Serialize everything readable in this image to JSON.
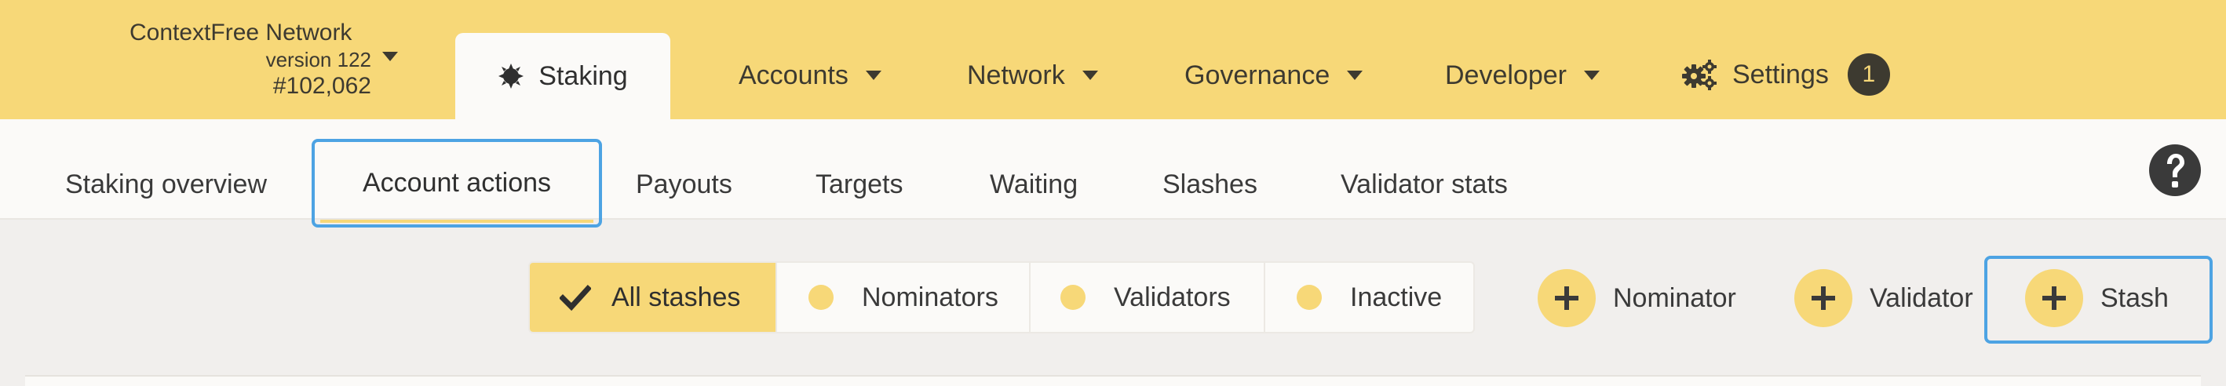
{
  "chain": {
    "name": "ContextFree Network",
    "version": "version 122",
    "block": "#102,062"
  },
  "top_menu": {
    "active_tab": "Staking",
    "accounts": "Accounts",
    "network": "Network",
    "governance": "Governance",
    "developer": "Developer",
    "settings": "Settings",
    "settings_badge": "1"
  },
  "sub_tabs": {
    "overview": "Staking overview",
    "account_actions": "Account actions",
    "payouts": "Payouts",
    "targets": "Targets",
    "waiting": "Waiting",
    "slashes": "Slashes",
    "validator_stats": "Validator stats"
  },
  "filters": {
    "all_stashes": "All stashes",
    "nominators": "Nominators",
    "validators": "Validators",
    "inactive": "Inactive",
    "selected": "All stashes"
  },
  "actions": {
    "nominator": "Nominator",
    "validator": "Validator",
    "stash": "Stash"
  },
  "icons": {
    "staking": "gear-sun-icon",
    "settings": "cogs-icon",
    "help": "question-circle-icon",
    "check": "check-icon",
    "plus": "plus-icon"
  },
  "colors": {
    "accent": "#f7d878",
    "focus_outline": "#4da3e3",
    "text_dark": "#3d3a30"
  }
}
